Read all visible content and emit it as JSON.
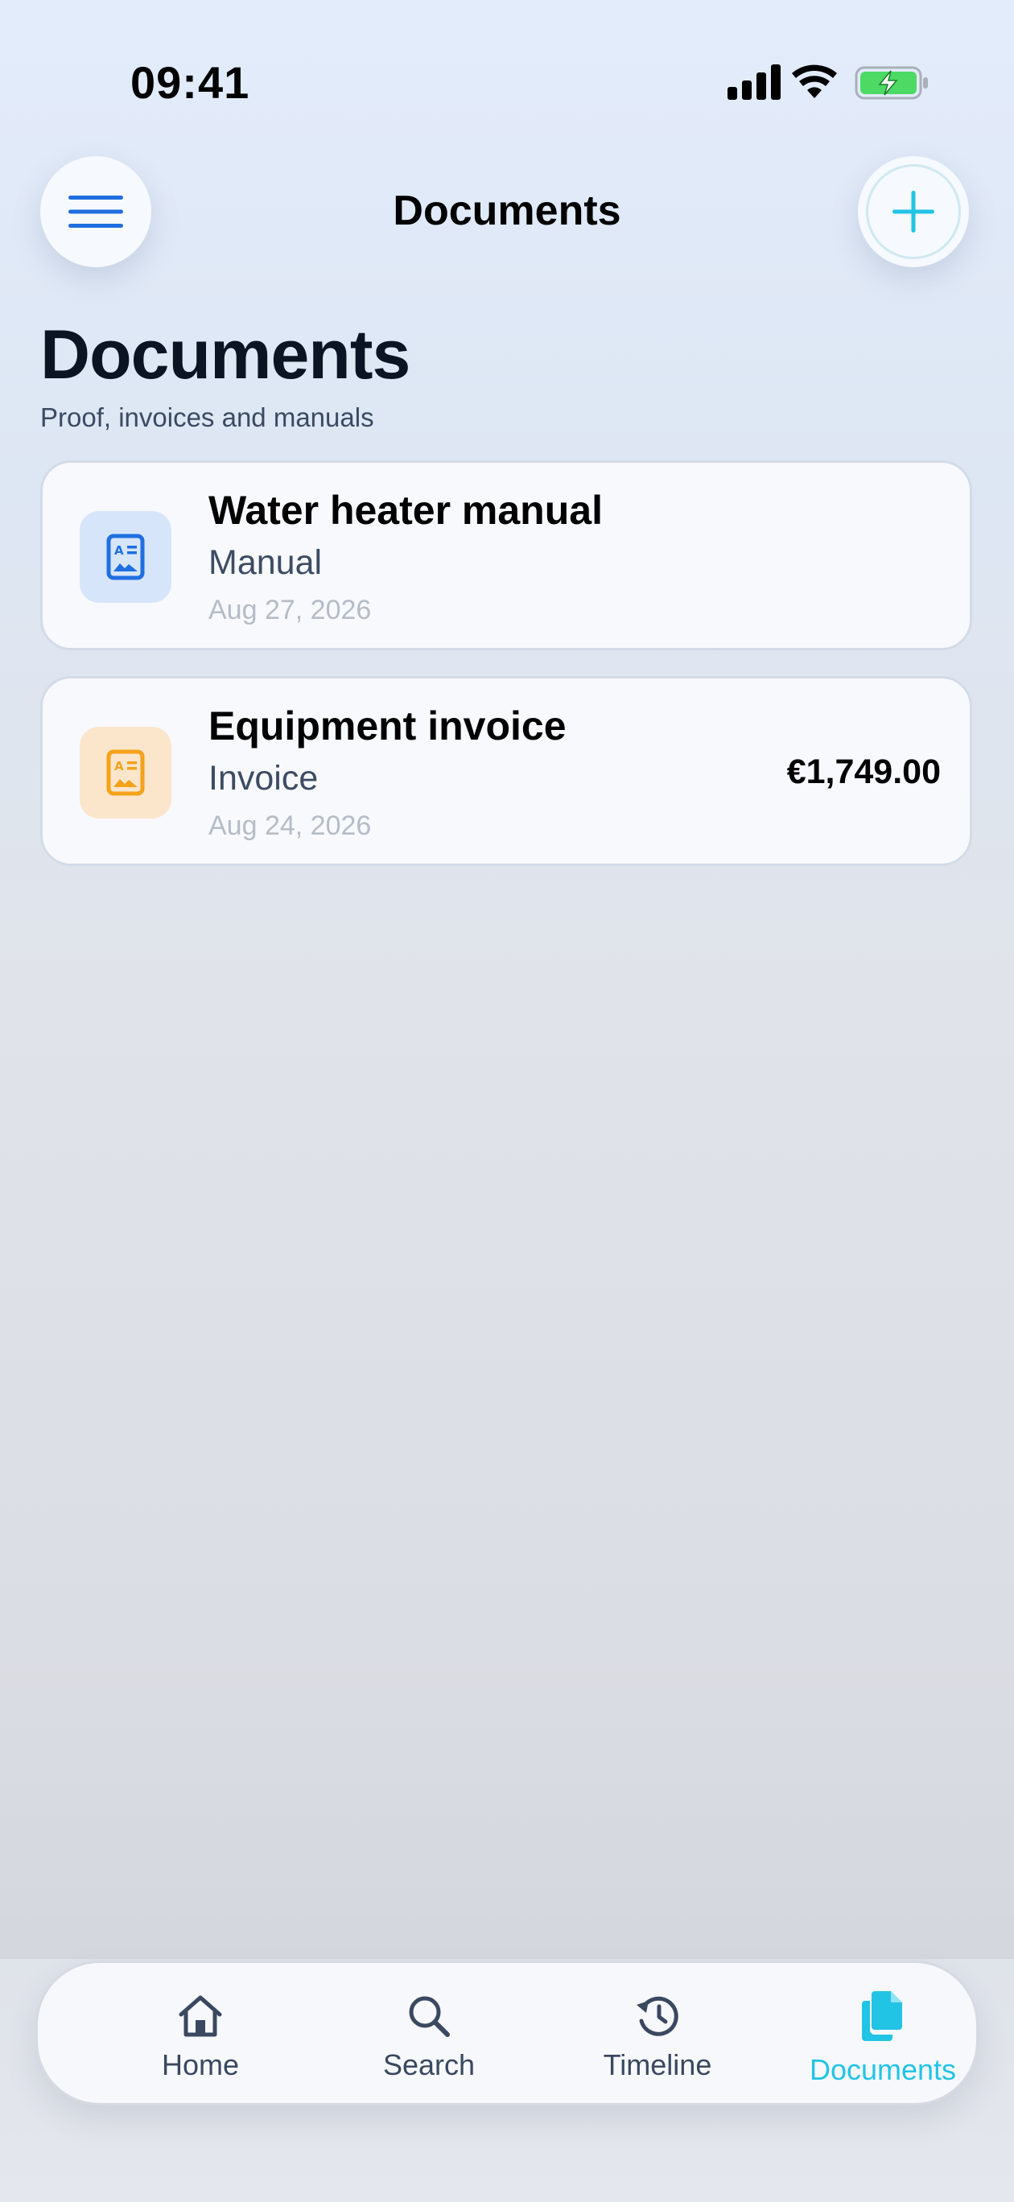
{
  "status_bar": {
    "time": "09:41"
  },
  "nav": {
    "title": "Documents"
  },
  "page": {
    "title": "Documents",
    "subtitle": "Proof, invoices and manuals"
  },
  "documents": [
    {
      "name": "Water heater manual",
      "type": "Manual",
      "date": "Aug 27, 2026",
      "amount": "",
      "icon": "document-image-icon",
      "color": "#1f6fe0"
    },
    {
      "name": "Equipment invoice",
      "type": "Invoice",
      "date": "Aug 24, 2026",
      "amount": "€1,749.00",
      "icon": "document-image-icon",
      "color": "#f5a21b"
    }
  ],
  "tabs": [
    {
      "label": "Home",
      "icon": "home-icon",
      "active": false
    },
    {
      "label": "Search",
      "icon": "search-icon",
      "active": false
    },
    {
      "label": "Timeline",
      "icon": "history-icon",
      "active": false
    },
    {
      "label": "Documents",
      "icon": "documents-icon",
      "active": true
    }
  ],
  "colors": {
    "accent": "#22c4e6",
    "menu_icon": "#1f6fe0",
    "battery": "#4cd964"
  }
}
